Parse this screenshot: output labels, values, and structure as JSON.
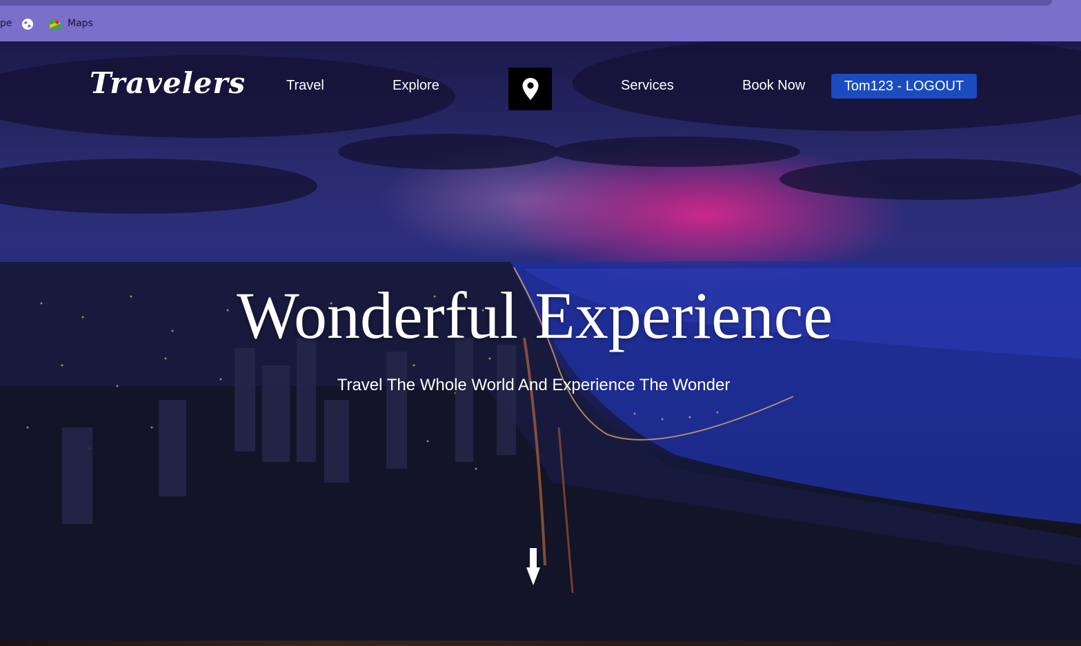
{
  "browser": {
    "bookmarks": [
      {
        "label": "pe",
        "icon": "truncated"
      },
      {
        "label": "",
        "icon": "globe-icon"
      },
      {
        "label": "Maps",
        "icon": "maps-icon"
      }
    ]
  },
  "nav": {
    "brand": "Travelers",
    "links": [
      "Travel",
      "Explore",
      "Services",
      "Book Now"
    ],
    "pin_icon": "location-pin-icon",
    "logout_label": "Tom123 - LOGOUT"
  },
  "hero": {
    "title": "Wonderful Experience",
    "subtitle": "Travel The Whole World And Experience The Wonder",
    "scroll_icon": "arrow-down-icon"
  },
  "colors": {
    "browser_bar": "#7a6fcb",
    "logout_button": "#1a4cc0",
    "pin_button": "#000000",
    "text": "#ffffff"
  }
}
